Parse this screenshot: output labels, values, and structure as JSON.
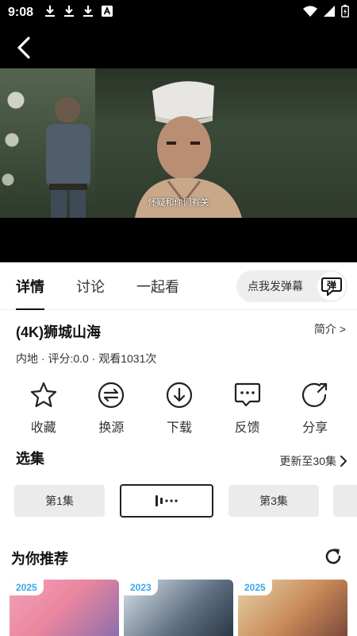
{
  "status_bar": {
    "time": "9:08",
    "notifications": [
      "download-icon",
      "download-icon",
      "download-icon",
      "app-a-icon"
    ],
    "indicators": [
      "wifi-icon",
      "signal-icon",
      "battery-icon"
    ]
  },
  "player": {
    "subtitle": "怀疑和你们有关"
  },
  "tabs": [
    {
      "label": "详情",
      "active": true
    },
    {
      "label": "讨论",
      "active": false
    },
    {
      "label": "一起看",
      "active": false
    }
  ],
  "danmaku": {
    "label": "点我发弹幕",
    "icon_text": "弹"
  },
  "show": {
    "title": "(4K)狮城山海",
    "intro_label": "简介 >",
    "meta": "内地 · 评分:0.0 · 观看1031次"
  },
  "actions": [
    {
      "label": "收藏",
      "icon": "star-icon"
    },
    {
      "label": "换源",
      "icon": "switch-source-icon"
    },
    {
      "label": "下载",
      "icon": "download-icon"
    },
    {
      "label": "反馈",
      "icon": "feedback-icon"
    },
    {
      "label": "分享",
      "icon": "share-icon"
    }
  ],
  "episodes": {
    "heading": "选集",
    "update_label": "更新至30集",
    "items": [
      {
        "label": "第1集",
        "playing": false
      },
      {
        "label": "",
        "playing": true
      },
      {
        "label": "第3集",
        "playing": false
      }
    ]
  },
  "recommend": {
    "heading": "为你推荐",
    "cards": [
      {
        "year": "2025"
      },
      {
        "year": "2023"
      },
      {
        "year": "2025"
      }
    ]
  },
  "colors": {
    "accent_year": "#3aa8e6",
    "status_bar_bg": "#000000",
    "chip_bg": "#ebebeb"
  }
}
